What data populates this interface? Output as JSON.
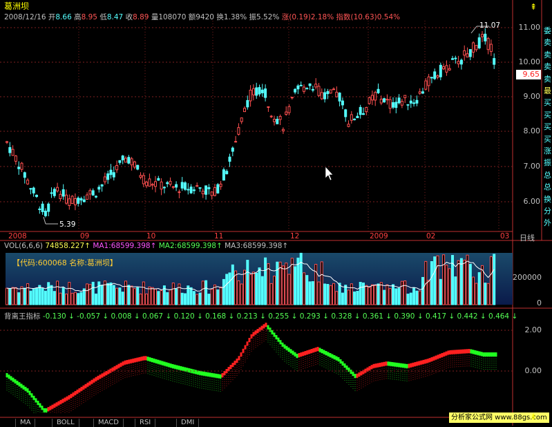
{
  "stock": {
    "name": "葛洲坝",
    "date": "2008/12/16",
    "open_label": "开",
    "open": "8.66",
    "high_label": "高",
    "high": "8.95",
    "low_label": "低",
    "low": "8.47",
    "close_label": "收",
    "close": "8.89",
    "volume_label": "量",
    "volume": "108070",
    "amount_label": "额",
    "amount": "9420",
    "turnover_label": "换",
    "turnover": "1.38%",
    "amplitude_label": "振",
    "amplitude": "5.52%",
    "change_label": "涨",
    "change": "(0.19)",
    "change_pct": "2.18%",
    "index_label": "指数",
    "index_change": "(10.63)",
    "index_pct": "0.54%"
  },
  "price_axis": [
    "11.00",
    "10.00",
    "9.00",
    "8.00",
    "7.00",
    "6.00"
  ],
  "current_price": "9.65",
  "annotations": {
    "high_point": "11.07",
    "low_point": "5.39"
  },
  "x_axis": [
    "2008",
    "09",
    "10",
    "11",
    "12",
    "2009",
    "02",
    "03"
  ],
  "period_label": "日线",
  "side_buttons": [
    "委",
    "卖",
    "卖",
    "卖",
    "卖",
    "最",
    "买",
    "买",
    "买",
    "买",
    "涨",
    "振",
    "总",
    "总",
    "换",
    "分",
    "外"
  ],
  "volume_panel": {
    "title": "VOL(6,6,6)",
    "value": "74858.227",
    "ma1_label": "MA1:",
    "ma1": "68599.398",
    "ma2_label": "MA2:",
    "ma2": "68599.398",
    "ma3_label": "MA3:",
    "ma3": "68599.398",
    "code_text": "【代码:600068 名称:葛洲坝】",
    "axis": [
      "200000",
      "0"
    ]
  },
  "indicator_panel": {
    "title": "背离王指标",
    "values": [
      "-0.130",
      "-0.057",
      "0.008",
      "0.067",
      "0.120",
      "0.168",
      "0.213",
      "0.255",
      "0.293",
      "0.328",
      "0.361",
      "0.390",
      "0.417",
      "0.442",
      "0.464"
    ],
    "axis": [
      "2.00",
      "0.00"
    ]
  },
  "bottom_tabs": [
    "MA",
    "BOLL",
    "MACD",
    "RSI",
    "DMI"
  ],
  "site_label": "分析家公式网 www.88gs.com",
  "colors": {
    "up": "#ff5050",
    "down": "#54ffff",
    "indicator_up": "#ff2020",
    "indicator_down": "#20ff20"
  }
}
